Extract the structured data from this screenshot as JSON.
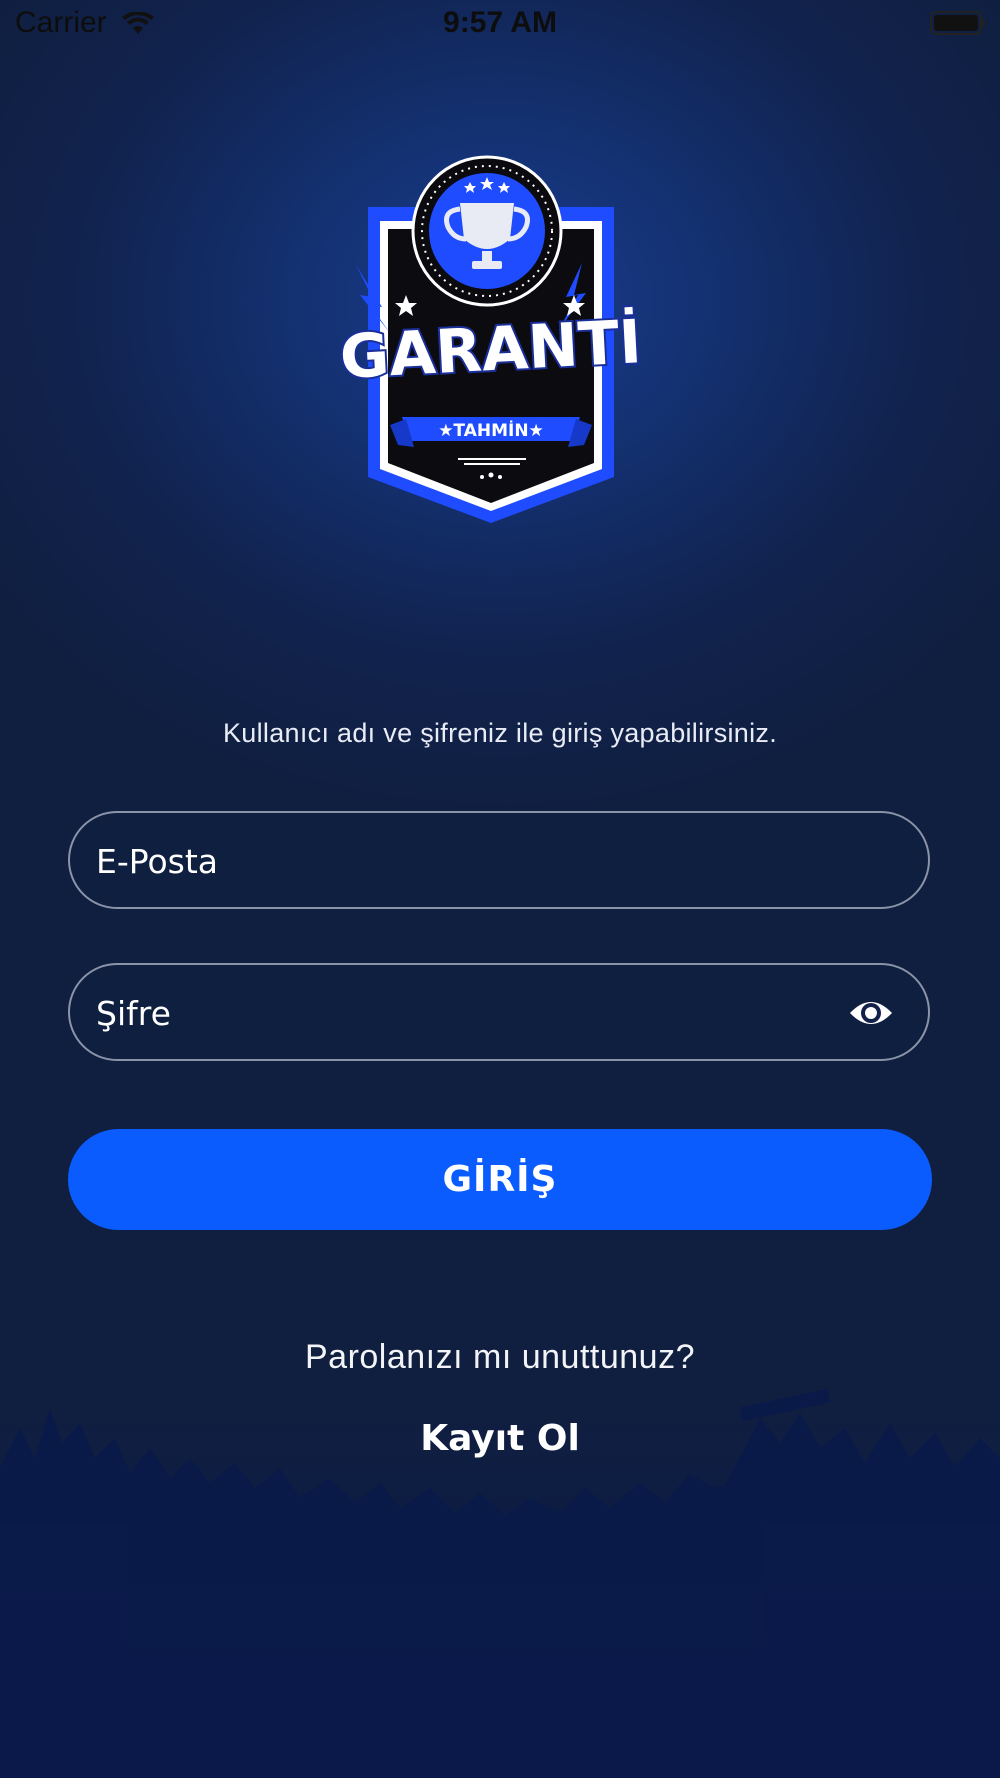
{
  "status_bar": {
    "carrier": "Carrier",
    "time": "9:57 AM",
    "icons": [
      "wifi-icon",
      "battery-icon"
    ]
  },
  "logo": {
    "wordmark": "GARANTİ",
    "ribbon": "★TAHMİN★",
    "icons": [
      "trophy-icon",
      "star-icon",
      "lightning-icon"
    ]
  },
  "login": {
    "subtitle": "Kullanıcı adı ve şifreniz ile giriş yapabilirsiniz.",
    "email_placeholder": "E-Posta",
    "password_placeholder": "Şifre",
    "submit_label": "GİRİŞ",
    "forgot_label": "Parolanızı mı unuttunuz?",
    "register_label": "Kayıt Ol"
  },
  "colors": {
    "accent": "#0a5cff",
    "background": "#101f40",
    "logo_blue": "#1f4cff"
  }
}
